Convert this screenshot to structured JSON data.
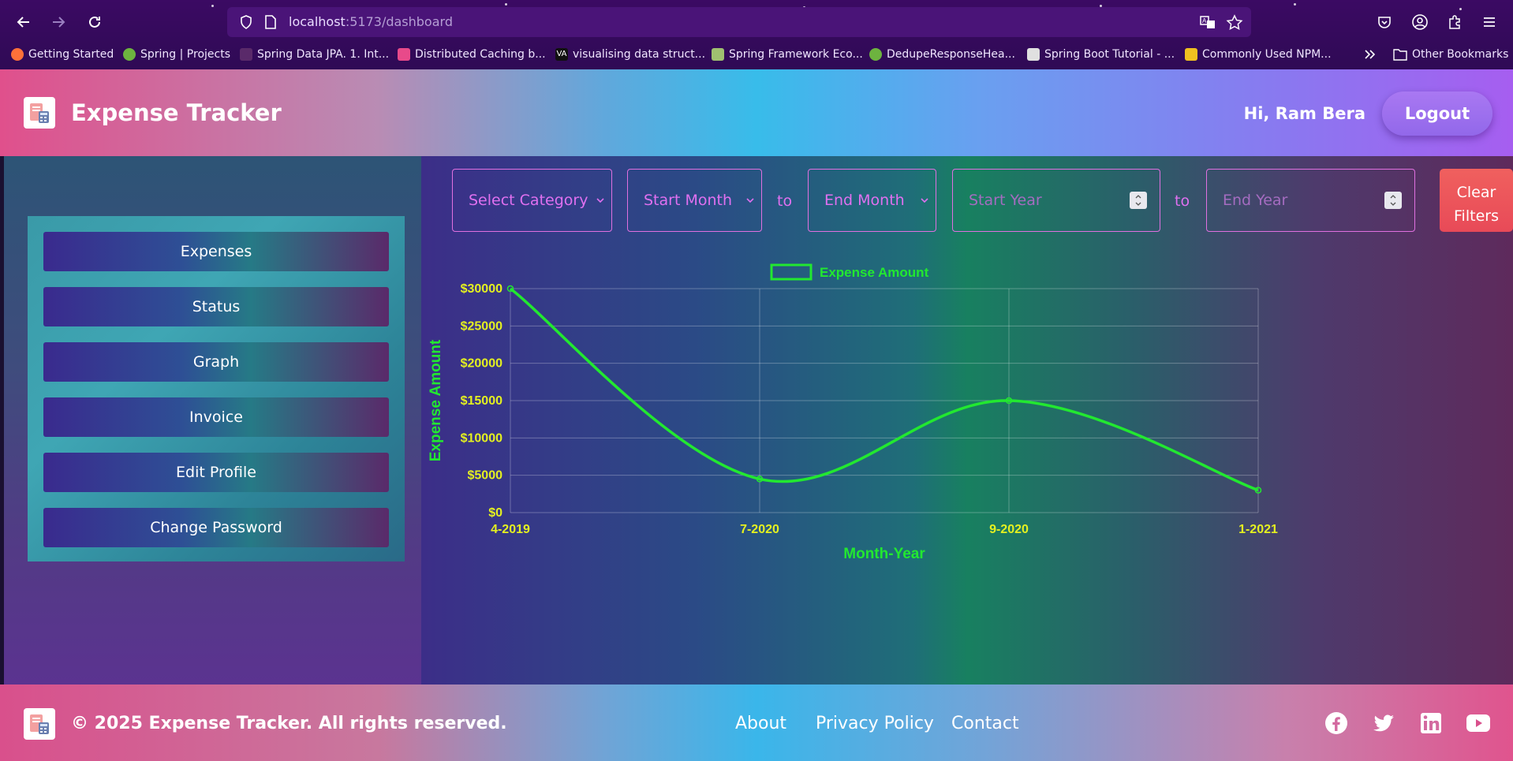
{
  "browser": {
    "url_host": "localhost",
    "url_path": ":5173/dashboard",
    "bookmarks": [
      {
        "label": "Getting Started",
        "color": "#ff7139"
      },
      {
        "label": "Spring | Projects",
        "color": "#6db33f"
      },
      {
        "label": "Spring Data JPA. 1. Int...",
        "color": "#5a2a6a"
      },
      {
        "label": "Distributed Caching b...",
        "color": "#e84a8a"
      },
      {
        "label": "visualising data struct...",
        "color": "#111111"
      },
      {
        "label": "Spring Framework Eco...",
        "color": "#9fc070"
      },
      {
        "label": "DedupeResponseHea...",
        "color": "#6db33f"
      },
      {
        "label": "Spring Boot Tutorial - ...",
        "color": "#e0e0e0"
      },
      {
        "label": "Commonly Used NPM...",
        "color": "#f0c020"
      },
      {
        "label": "Other Bookmarks",
        "color": "#ffffff"
      }
    ]
  },
  "header": {
    "title": "Expense Tracker",
    "greeting": "Hi, Ram Bera",
    "logout_label": "Logout"
  },
  "sidebar": {
    "items": [
      {
        "label": "Expenses"
      },
      {
        "label": "Status"
      },
      {
        "label": "Graph"
      },
      {
        "label": "Invoice"
      },
      {
        "label": "Edit Profile"
      },
      {
        "label": "Change Password"
      }
    ]
  },
  "filters": {
    "category": "Select Category",
    "start_month": "Start Month",
    "to1": "to",
    "end_month": "End Month",
    "start_year_placeholder": "Start Year",
    "to2": "to",
    "end_year_placeholder": "End Year",
    "clear_line1": "Clear",
    "clear_line2": "Filters"
  },
  "chart_data": {
    "type": "line",
    "categories": [
      "4-2019",
      "7-2020",
      "9-2020",
      "1-2021"
    ],
    "series": [
      {
        "name": "Expense Amount",
        "values": [
          30000,
          4500,
          15000,
          3000
        ],
        "color": "#22e830"
      }
    ],
    "xlabel": "Month-Year",
    "ylabel": "Expense Amount",
    "ylim": [
      0,
      30000
    ],
    "yticks": [
      "$0",
      "$5000",
      "$10000",
      "$15000",
      "$20000",
      "$25000",
      "$30000"
    ],
    "grid": true,
    "legend": "top-center"
  },
  "footer": {
    "copyright": "© 2025 Expense Tracker. All rights reserved.",
    "links": [
      "About",
      "Privacy Policy",
      "Contact"
    ],
    "social": [
      "facebook-icon",
      "twitter-icon",
      "linkedin-icon",
      "youtube-icon"
    ]
  }
}
